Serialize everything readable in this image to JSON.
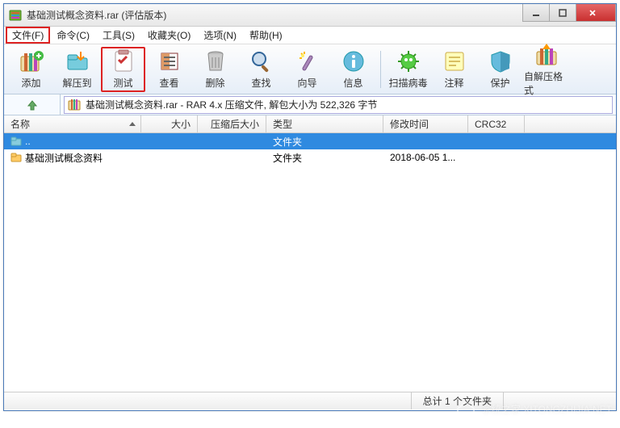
{
  "titlebar": {
    "title": "基础测试概念资料.rar (评估版本)"
  },
  "menu": {
    "file": "文件(F)",
    "command": "命令(C)",
    "tools": "工具(S)",
    "favorites": "收藏夹(O)",
    "options": "选项(N)",
    "help": "帮助(H)"
  },
  "toolbar": {
    "add": "添加",
    "extract_to": "解压到",
    "test": "测试",
    "view": "查看",
    "delete": "删除",
    "find": "查找",
    "wizard": "向导",
    "info": "信息",
    "virus": "扫描病毒",
    "comment": "注释",
    "protect": "保护",
    "sfx": "自解压格式"
  },
  "address": {
    "text": "基础测试概念资料.rar - RAR 4.x 压缩文件, 解包大小为 522,326 字节"
  },
  "columns": {
    "name": "名称",
    "size": "大小",
    "packed": "压缩后大小",
    "type": "类型",
    "modified": "修改时间",
    "crc": "CRC32"
  },
  "col_widths": {
    "name": 170,
    "size": 70,
    "packed": 85,
    "type": 145,
    "modified": 105,
    "crc": 70
  },
  "rows": [
    {
      "name": "..",
      "type": "文件夹",
      "modified": "",
      "selected": true
    },
    {
      "name": "基础测试概念资料",
      "type": "文件夹",
      "modified": "2018-06-05 1...",
      "selected": false
    }
  ],
  "status": {
    "summary": "总计 1 个文件夹"
  },
  "watermark": "系统之家 XITONGZHIJIA.NET"
}
